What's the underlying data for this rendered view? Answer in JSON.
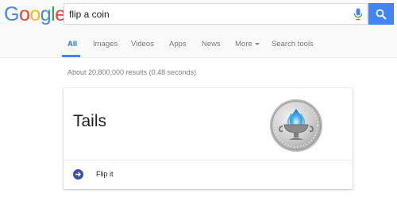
{
  "logo": {
    "text": "Google"
  },
  "search": {
    "query": "flip a coin"
  },
  "tabs": [
    {
      "label": "All"
    },
    {
      "label": "Images"
    },
    {
      "label": "Videos"
    },
    {
      "label": "Apps"
    },
    {
      "label": "News"
    },
    {
      "label": "More"
    },
    {
      "label": "Search tools"
    }
  ],
  "results_stats": "About 20,800,000 results (0.48 seconds)",
  "coin_card": {
    "result": "Tails",
    "action_label": "Flip it"
  },
  "colors": {
    "accent": "#4285f4",
    "flip_icon": "#3a51a8",
    "logo_blue": "#4285f4",
    "logo_red": "#ea4335",
    "logo_yellow": "#fbbc05",
    "logo_green": "#34a853"
  },
  "icons": {
    "mic": "microphone-icon",
    "search": "magnifier-icon",
    "flip": "arrow-right-circle-icon",
    "coin": "coin-tails-icon",
    "more": "caret-down-icon"
  }
}
